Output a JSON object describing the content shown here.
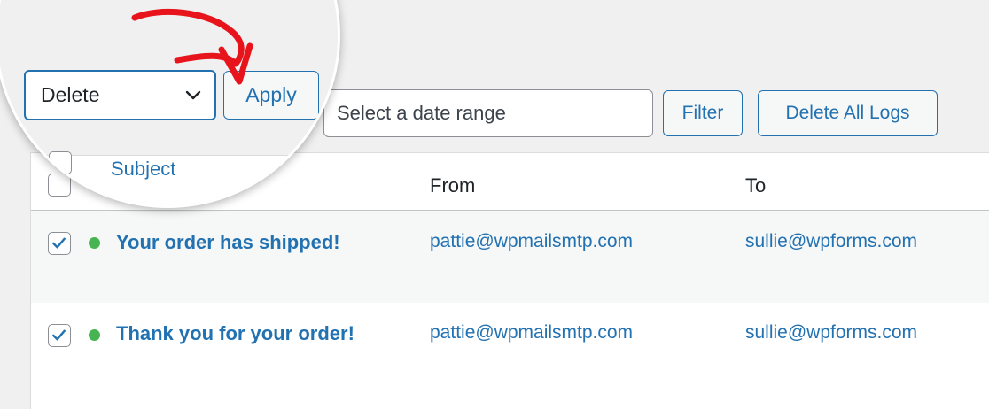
{
  "toolbar": {
    "bulk_action_value": "Delete",
    "apply_label": "Apply",
    "count_fragment": ".)",
    "date_range_placeholder": "Select a date range",
    "filter_label": "Filter",
    "delete_all_label": "Delete All Logs"
  },
  "table": {
    "columns": {
      "subject": "Subject",
      "from": "From",
      "to": "To"
    },
    "rows": [
      {
        "checked": true,
        "status": "sent",
        "subject": "Your order has shipped!",
        "from": "pattie@wpmailsmtp.com",
        "to": "sullie@wpforms.com"
      },
      {
        "checked": true,
        "status": "sent",
        "subject": "Thank you for your order!",
        "from": "pattie@wpmailsmtp.com",
        "to": "sullie@wpforms.com"
      }
    ]
  },
  "colors": {
    "accent": "#2271b1",
    "status_sent": "#46b450",
    "annotation_arrow": "#e8141c",
    "page_background": "#f0f0f1"
  },
  "icons": {
    "select_chevron": "chevron-down-icon",
    "checkbox_check": "checkmark-icon",
    "status": "status-dot-icon",
    "annotation": "red-arrow-annotation"
  }
}
